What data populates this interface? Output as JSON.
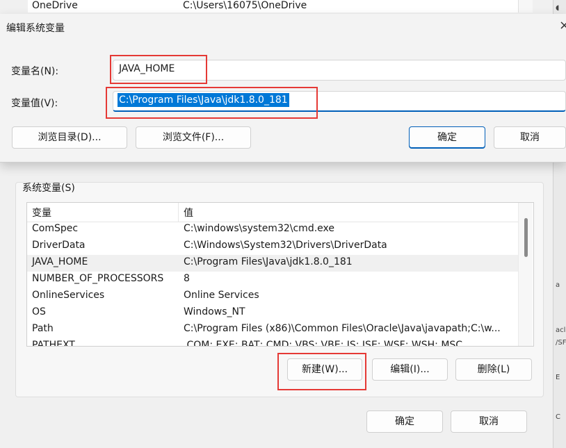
{
  "user_vars": {
    "row": {
      "name": "OneDrive",
      "value": "C:\\Users\\16075\\OneDrive"
    }
  },
  "system_vars": {
    "label": "系统变量(S)",
    "headers": {
      "name": "变量",
      "value": "值"
    },
    "rows": [
      {
        "name": "ComSpec",
        "value": "C:\\windows\\system32\\cmd.exe"
      },
      {
        "name": "DriverData",
        "value": "C:\\Windows\\System32\\Drivers\\DriverData"
      },
      {
        "name": "JAVA_HOME",
        "value": "C:\\Program Files\\Java\\jdk1.8.0_181"
      },
      {
        "name": "NUMBER_OF_PROCESSORS",
        "value": "8"
      },
      {
        "name": "OnlineServices",
        "value": "Online Services"
      },
      {
        "name": "OS",
        "value": "Windows_NT"
      },
      {
        "name": "Path",
        "value": "C:\\Program Files (x86)\\Common Files\\Oracle\\Java\\javapath;C:\\w..."
      },
      {
        "name": "PATHEXT",
        "value": ".COM;.EXE;.BAT;.CMD;.VBS;.VBE;.JS;.JSE;.WSF;.WSH;.MSC"
      }
    ],
    "buttons": {
      "new": "新建(W)...",
      "edit": "编辑(I)...",
      "delete": "删除(L)"
    }
  },
  "main_buttons": {
    "ok": "确定",
    "cancel": "取消"
  },
  "edit_dialog": {
    "title": "编辑系统变量",
    "name_label": "变量名(N):",
    "name_value": "JAVA_HOME",
    "value_label": "变量值(V):",
    "value_value": "C:\\Program Files\\Java\\jdk1.8.0_181",
    "buttons": {
      "browse_dir": "浏览目录(D)...",
      "browse_file": "浏览文件(F)...",
      "ok": "确定",
      "cancel": "取消"
    }
  },
  "colors": {
    "accent": "#005fb8",
    "selection": "#0078d7",
    "annotation": "#e53935"
  }
}
